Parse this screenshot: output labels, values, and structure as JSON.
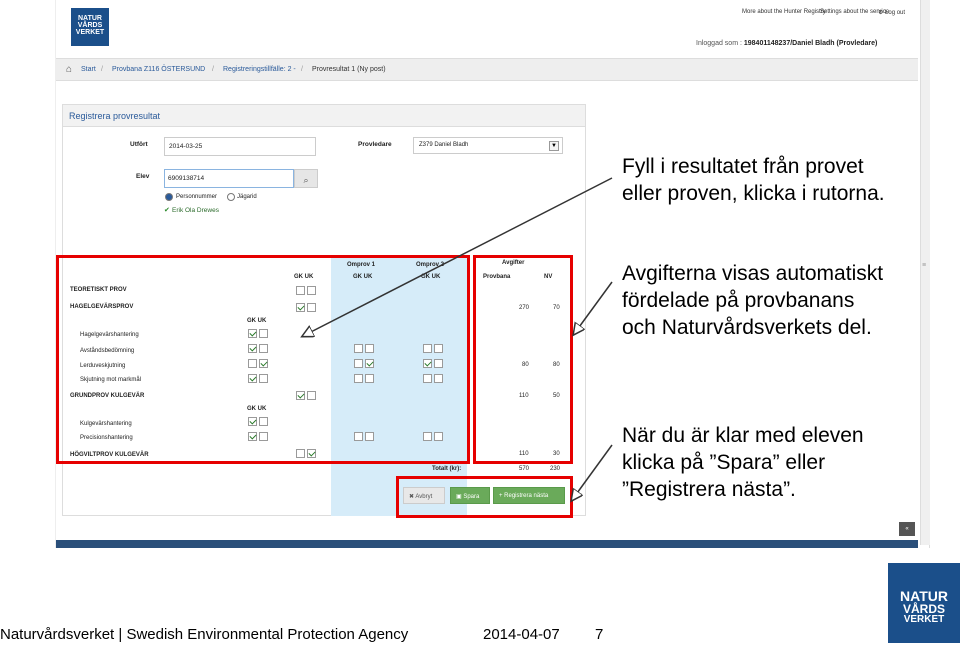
{
  "logo": {
    "line1": "NATUR",
    "line2": "VÅRDS",
    "line3": "VERKET"
  },
  "top_links": {
    "more": "More about the Hunter Registry",
    "service": "Settings about the service",
    "logout": "Log out"
  },
  "login_info": {
    "prefix": "Inloggad som :",
    "user": "198401148237/Daniel Bladh (Provledare)"
  },
  "breadcrumb": [
    "Start",
    "Provbana Z116 ÖSTERSUND",
    "Registreringstillfälle: 2 -",
    "Provresultat 1 (Ny post)"
  ],
  "panel_title": "Registrera provresultat",
  "form": {
    "utfort_label": "Utfört",
    "utfort_value": "2014-03-25",
    "provledare_label": "Provledare",
    "provledare_value": "Z379 Daniel Bladh",
    "elev_label": "Elev",
    "elev_value": "6909138714",
    "radio1": "Personnummer",
    "radio2": "Jägarid",
    "found_name": "Erik Ola Drewes"
  },
  "table": {
    "headers": {
      "omprov1": "Omprov 1",
      "omprov2": "Omprov 2",
      "avgifter": "Avgifter",
      "gkuk": "GK UK",
      "provbana": "Provbana",
      "nv": "NV"
    },
    "rows": {
      "teoretiskt": "TEORETISKT PROV",
      "hagel": "HAGELGEVÄRSPROV",
      "hagel_pb": "270",
      "hagel_nv": "70",
      "hagel_sub_gkuk": "GK UK",
      "hagelhant": "Hagelgevärshantering",
      "avstand": "Avståndsbedömning",
      "lerduve": "Lerduveskjutning",
      "lerduve_pb": "80",
      "lerduve_nv": "80",
      "skjutning": "Skjutning mot markmål",
      "grund": "GRUNDPROV KULGEVÄR",
      "grund_pb": "110",
      "grund_nv": "50",
      "grund_sub_gkuk": "GK UK",
      "kulhant": "Kulgevärshantering",
      "precision": "Precisionshantering",
      "hogvilt": "HÖGVILTPROV KULGEVÄR",
      "hogvilt_pb": "110",
      "hogvilt_nv": "30",
      "totalt_label": "Totalt (kr):",
      "totalt_pb": "570",
      "totalt_nv": "230"
    }
  },
  "buttons": {
    "avbryt": "Avbryt",
    "spara": "Spara",
    "registrera_nasta": "Registrera nästa"
  },
  "callouts": {
    "c1": [
      "Fyll i resultatet från provet",
      "eller proven, klicka i rutorna."
    ],
    "c2": [
      "Avgifterna visas automatiskt",
      "fördelade på provbanans",
      "och Naturvårdsverkets del."
    ],
    "c3": [
      "När du är klar med eleven",
      "klicka på ”Spara” eller",
      "”Registrera nästa”."
    ]
  },
  "footer": {
    "agency": "Naturvårdsverket | Swedish Environmental Protection Agency",
    "date": "2014-04-07",
    "page": "7"
  },
  "colors": {
    "brand": "#1b4f8a",
    "highlight": "#e60000",
    "omprov_bg": "#d6ecf9",
    "save_green": "#6aaa5a"
  }
}
